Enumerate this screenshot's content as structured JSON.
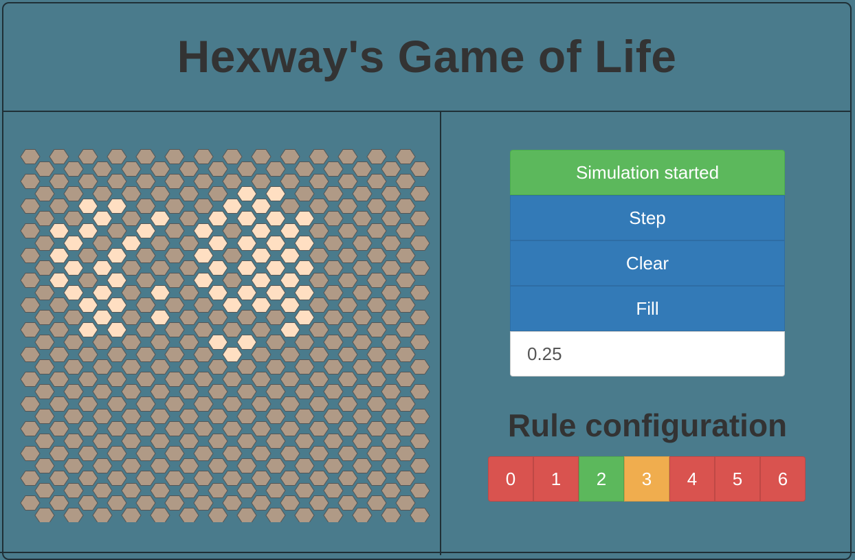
{
  "app": {
    "title": "Hexway's Game of Life"
  },
  "board": {
    "cols": 14,
    "rows": 30,
    "dead_color": "#b09a86",
    "alive_color": "#ffdfc2",
    "stroke_color": "#555555",
    "alive_cells": [
      [
        3,
        7
      ],
      [
        3,
        8
      ],
      [
        4,
        7
      ],
      [
        4,
        8
      ],
      [
        5,
        6
      ],
      [
        5,
        7
      ],
      [
        5,
        8
      ],
      [
        6,
        6
      ],
      [
        6,
        8
      ],
      [
        7,
        6
      ],
      [
        7,
        7
      ],
      [
        7,
        8
      ],
      [
        8,
        6
      ],
      [
        8,
        8
      ],
      [
        9,
        6
      ],
      [
        9,
        7
      ],
      [
        9,
        8
      ],
      [
        10,
        6
      ],
      [
        10,
        8
      ],
      [
        11,
        6
      ],
      [
        11,
        7
      ],
      [
        11,
        8
      ],
      [
        12,
        7
      ],
      [
        12,
        8
      ],
      [
        4,
        2
      ],
      [
        4,
        3
      ],
      [
        5,
        2
      ],
      [
        5,
        4
      ],
      [
        6,
        1
      ],
      [
        6,
        2
      ],
      [
        6,
        4
      ],
      [
        7,
        1
      ],
      [
        7,
        3
      ],
      [
        8,
        1
      ],
      [
        8,
        3
      ],
      [
        9,
        1
      ],
      [
        9,
        2
      ],
      [
        10,
        1
      ],
      [
        10,
        3
      ],
      [
        11,
        1
      ],
      [
        11,
        2
      ],
      [
        11,
        4
      ],
      [
        12,
        2
      ],
      [
        12,
        3
      ],
      [
        13,
        2
      ],
      [
        13,
        4
      ],
      [
        14,
        2
      ],
      [
        14,
        3
      ],
      [
        5,
        9
      ],
      [
        6,
        9
      ],
      [
        7,
        9
      ],
      [
        8,
        9
      ],
      [
        9,
        9
      ],
      [
        10,
        9
      ],
      [
        11,
        9
      ],
      [
        12,
        9
      ],
      [
        13,
        9
      ],
      [
        14,
        9
      ],
      [
        15,
        6
      ],
      [
        15,
        7
      ],
      [
        16,
        7
      ]
    ]
  },
  "controls": {
    "start_label": "Simulation started",
    "step_label": "Step",
    "clear_label": "Clear",
    "fill_label": "Fill",
    "fill_value": "0.25"
  },
  "rules": {
    "title": "Rule configuration",
    "items": [
      {
        "label": "0",
        "state": "dead",
        "color": "#d9534f"
      },
      {
        "label": "1",
        "state": "dead",
        "color": "#d9534f"
      },
      {
        "label": "2",
        "state": "survive",
        "color": "#5cb85c"
      },
      {
        "label": "3",
        "state": "born",
        "color": "#f0ad4e"
      },
      {
        "label": "4",
        "state": "dead",
        "color": "#d9534f"
      },
      {
        "label": "5",
        "state": "dead",
        "color": "#d9534f"
      },
      {
        "label": "6",
        "state": "dead",
        "color": "#d9534f"
      }
    ]
  }
}
